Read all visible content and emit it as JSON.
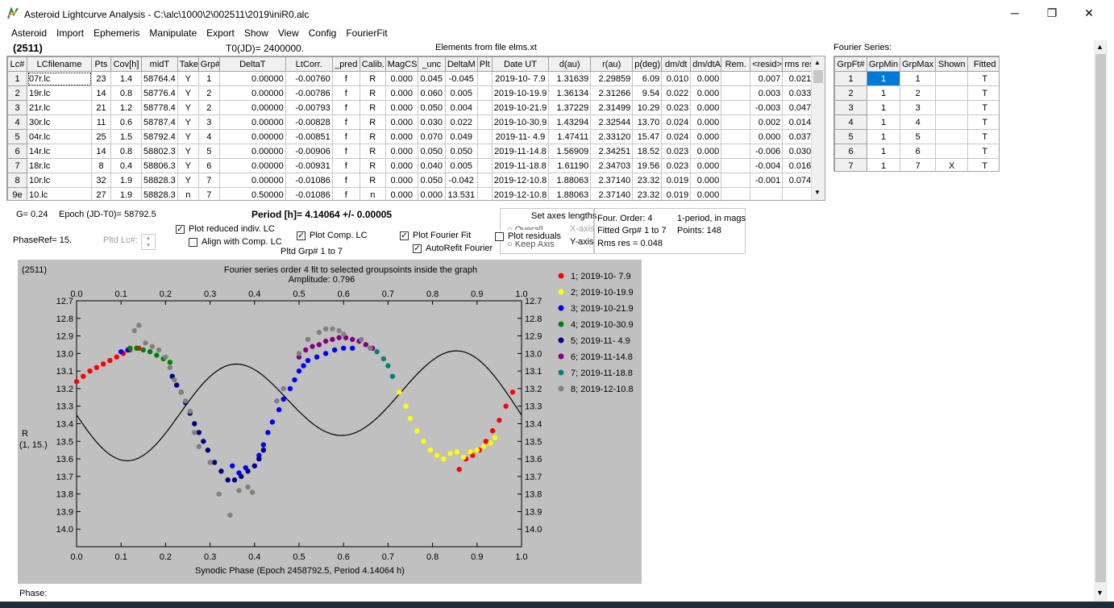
{
  "window": {
    "title": "Asteroid Lightcurve Analysis - C:\\alc\\1000\\2\\002511\\2019\\iniR0.alc",
    "min": "─",
    "max": "❐",
    "close": "✕"
  },
  "menu": [
    "Asteroid",
    "Import",
    "Ephemeris",
    "Manipulate",
    "Export",
    "Show",
    "View",
    "Config",
    "FourierFit"
  ],
  "header": {
    "asteroid": "(2511)",
    "t0": "T0(JD)= 2400000.",
    "elements": "Elements from file elms.xt"
  },
  "grid": {
    "columns": [
      "Lc#",
      "LCfilename",
      "Pts",
      "Cov[h]",
      "midT",
      "Take",
      "Grp#",
      "DeltaT",
      "LtCorr.",
      "_pred",
      "Calib.",
      "MagCS",
      "_unc",
      "DeltaM",
      "Plt",
      "Date UT",
      "d(au)",
      "r(au)",
      "p(deg)",
      "dm/dt",
      "dm/dtA",
      "Rem.",
      "<resid>",
      "rms res"
    ],
    "rows": [
      [
        "1",
        "07r.lc",
        "23",
        "1.4",
        "58764.4",
        "Y",
        "1",
        "0.00000",
        "-0.00760",
        "f",
        "R",
        "0.000",
        "0.045",
        "-0.045",
        "",
        "2019-10- 7.9",
        "1.31639",
        "2.29859",
        "6.09",
        "0.010",
        "0.000",
        "",
        "0.007",
        "0.021"
      ],
      [
        "2",
        "19r.lc",
        "14",
        "0.8",
        "58776.4",
        "Y",
        "2",
        "0.00000",
        "-0.00786",
        "f",
        "R",
        "0.000",
        "0.060",
        "0.005",
        "",
        "2019-10-19.9",
        "1.36134",
        "2.31266",
        "9.54",
        "0.022",
        "0.000",
        "",
        "0.003",
        "0.033"
      ],
      [
        "3",
        "21r.lc",
        "21",
        "1.2",
        "58778.4",
        "Y",
        "2",
        "0.00000",
        "-0.00793",
        "f",
        "R",
        "0.000",
        "0.050",
        "0.004",
        "",
        "2019-10-21.9",
        "1.37229",
        "2.31499",
        "10.29",
        "0.023",
        "0.000",
        "",
        "-0.003",
        "0.047"
      ],
      [
        "4",
        "30r.lc",
        "11",
        "0.6",
        "58787.4",
        "Y",
        "3",
        "0.00000",
        "-0.00828",
        "f",
        "R",
        "0.000",
        "0.030",
        "0.022",
        "",
        "2019-10-30.9",
        "1.43294",
        "2.32544",
        "13.70",
        "0.024",
        "0.000",
        "",
        "0.002",
        "0.014"
      ],
      [
        "5",
        "04r.lc",
        "25",
        "1.5",
        "58792.4",
        "Y",
        "4",
        "0.00000",
        "-0.00851",
        "f",
        "R",
        "0.000",
        "0.070",
        "0.049",
        "",
        "2019-11- 4.9",
        "1.47411",
        "2.33120",
        "15.47",
        "0.024",
        "0.000",
        "",
        "0.000",
        "0.037"
      ],
      [
        "6",
        "14r.lc",
        "14",
        "0.8",
        "58802.3",
        "Y",
        "5",
        "0.00000",
        "-0.00906",
        "f",
        "R",
        "0.000",
        "0.050",
        "0.050",
        "",
        "2019-11-14.8",
        "1.56909",
        "2.34251",
        "18.52",
        "0.023",
        "0.000",
        "",
        "-0.006",
        "0.030"
      ],
      [
        "7",
        "18r.lc",
        "8",
        "0.4",
        "58806.3",
        "Y",
        "6",
        "0.00000",
        "-0.00931",
        "f",
        "R",
        "0.000",
        "0.040",
        "0.005",
        "",
        "2019-11-18.8",
        "1.61190",
        "2.34703",
        "19.56",
        "0.023",
        "0.000",
        "",
        "-0.004",
        "0.016"
      ],
      [
        "8",
        "10r.lc",
        "32",
        "1.9",
        "58828.3",
        "Y",
        "7",
        "0.00000",
        "-0.01086",
        "f",
        "R",
        "0.000",
        "0.050",
        "-0.042",
        "",
        "2019-12-10.8",
        "1.88063",
        "2.37140",
        "23.32",
        "0.019",
        "0.000",
        "",
        "-0.001",
        "0.074"
      ],
      [
        "9e",
        "10.lc",
        "27",
        "1.9",
        "58828.3",
        "n",
        "7",
        "0.50000",
        "-0.01086",
        "f",
        "n",
        "0.000",
        "0.000",
        "13.531",
        "",
        "2019-12-10.8",
        "1.88063",
        "2.37140",
        "23.32",
        "0.019",
        "0.000",
        "",
        "",
        ""
      ]
    ]
  },
  "fourier_panel": {
    "title": "Fourier Series:",
    "columns": [
      "GrpFt#",
      "GrpMin",
      "GrpMax",
      "Shown",
      "Fitted"
    ],
    "rows": [
      [
        "1",
        "1",
        "1",
        "",
        "T"
      ],
      [
        "2",
        "1",
        "2",
        "",
        "T"
      ],
      [
        "3",
        "1",
        "3",
        "",
        "T"
      ],
      [
        "4",
        "1",
        "4",
        "",
        "T"
      ],
      [
        "5",
        "1",
        "5",
        "",
        "T"
      ],
      [
        "6",
        "1",
        "6",
        "",
        "T"
      ],
      [
        "7",
        "1",
        "7",
        "X",
        "T"
      ]
    ]
  },
  "controls": {
    "g": "G= 0.24",
    "epoch": "Epoch (JD-T0)= 58792.5",
    "period": "Period [h]= 4.14064 +/- 0.00005",
    "phaseref": "PhaseRef= 15.",
    "pltd_lc": "Pltd Lc#:",
    "plot_reduced": "Plot reduced indiv. LC",
    "align_comp": "Align with Comp. LC",
    "plot_comp": "Plot Comp. LC",
    "pltd_grp": "Pltd Grp#  1   to   7",
    "plot_fourier": "Plot Fourier Fit",
    "autorefit": "AutoRefit Fourier",
    "set_axes": "Set axes lengths",
    "overall": "Overall",
    "keep_axis": "Keep Axis",
    "plot_residuals": "Plot residuals",
    "x_axis": "X-axis",
    "y_axis": "Y-axis",
    "check_mark": "✓",
    "shown_mark": "X",
    "four_order": "Four. Order:  4",
    "one_period": "1-period, in mags",
    "fitted_grp": "Fitted Grp# 1 to 7",
    "points": "Points: 148",
    "rms_res": "Rms res      = 0.048",
    "phase_label": "Phase:"
  },
  "chart_data": {
    "type": "scatter",
    "corner_label": "(2511)",
    "title": "Fourier series order 4 fit to selected groupsoints inside the graph",
    "subtitle": "Amplitude: 0.796",
    "xlabel": "Synodic Phase (Epoch 2458792.5, Period 4.14064 h)",
    "ylabel": "R",
    "ylabel2": "(1, 15.)",
    "xlim": [
      0.0,
      1.0
    ],
    "ylim": [
      12.7,
      14.1
    ],
    "y_inverted": true,
    "x_ticks": [
      "0.0",
      "0.1",
      "0.2",
      "0.3",
      "0.4",
      "0.5",
      "0.6",
      "0.7",
      "0.8",
      "0.9",
      "1.0"
    ],
    "y_ticks": [
      "12.7",
      "12.8",
      "12.9",
      "13.0",
      "13.1",
      "13.2",
      "13.3",
      "13.4",
      "13.5",
      "13.6",
      "13.7",
      "13.8",
      "13.9",
      "14.0"
    ],
    "fourier_curve": {
      "mean": 13.28,
      "a": [
        0.02,
        0.06,
        -0.01,
        0.0
      ],
      "b": [
        0.07,
        0.25,
        0.01,
        0.0
      ],
      "color": "#000000"
    },
    "series": [
      {
        "name": "1; 2019-10- 7.9",
        "color": "#ff0000",
        "points": [
          [
            0.0,
            13.16
          ],
          [
            0.015,
            13.13
          ],
          [
            0.03,
            13.1
          ],
          [
            0.045,
            13.08
          ],
          [
            0.06,
            13.06
          ],
          [
            0.075,
            13.04
          ],
          [
            0.09,
            13.02
          ],
          [
            0.105,
            13.0
          ],
          [
            0.12,
            12.98
          ],
          [
            0.14,
            12.97
          ],
          [
            0.86,
            13.66
          ],
          [
            0.875,
            13.6
          ],
          [
            0.89,
            13.58
          ],
          [
            0.905,
            13.55
          ],
          [
            0.92,
            13.5
          ],
          [
            0.935,
            13.44
          ],
          [
            0.95,
            13.38
          ],
          [
            0.965,
            13.3
          ],
          [
            0.98,
            13.22
          ]
        ]
      },
      {
        "name": "2; 2019-10-19.9",
        "color": "#ffff00",
        "points": [
          [
            0.725,
            13.22
          ],
          [
            0.74,
            13.3
          ],
          [
            0.75,
            13.37
          ],
          [
            0.765,
            13.44
          ],
          [
            0.78,
            13.5
          ],
          [
            0.795,
            13.55
          ],
          [
            0.81,
            13.58
          ],
          [
            0.825,
            13.6
          ],
          [
            0.84,
            13.57
          ],
          [
            0.855,
            13.56
          ],
          [
            0.87,
            13.59
          ],
          [
            0.885,
            13.56
          ],
          [
            0.9,
            13.55
          ],
          [
            0.915,
            13.53
          ],
          [
            0.93,
            13.51
          ],
          [
            0.94,
            13.48
          ]
        ]
      },
      {
        "name": "3; 2019-10-21.9",
        "color": "#0000ff",
        "points": [
          [
            0.1,
            12.99
          ],
          [
            0.115,
            12.98
          ],
          [
            0.35,
            13.64
          ],
          [
            0.365,
            13.68
          ],
          [
            0.38,
            13.65
          ],
          [
            0.41,
            13.58
          ],
          [
            0.42,
            13.52
          ],
          [
            0.43,
            13.45
          ],
          [
            0.44,
            13.39
          ],
          [
            0.455,
            13.32
          ],
          [
            0.465,
            13.26
          ],
          [
            0.48,
            13.2
          ],
          [
            0.49,
            13.15
          ],
          [
            0.5,
            13.1
          ],
          [
            0.51,
            13.07
          ],
          [
            0.52,
            13.04
          ],
          [
            0.54,
            13.02
          ],
          [
            0.56,
            13.0
          ],
          [
            0.58,
            12.98
          ],
          [
            0.6,
            12.97
          ],
          [
            0.62,
            12.97
          ]
        ]
      },
      {
        "name": "4; 2019-10-30.9",
        "color": "#008000",
        "points": [
          [
            0.12,
            12.97
          ],
          [
            0.135,
            12.97
          ],
          [
            0.15,
            12.98
          ],
          [
            0.165,
            12.99
          ],
          [
            0.18,
            13.01
          ],
          [
            0.195,
            13.03
          ],
          [
            0.21,
            13.05
          ]
        ]
      },
      {
        "name": "5; 2019-11- 4.9",
        "color": "#000080",
        "points": [
          [
            0.215,
            13.13
          ],
          [
            0.225,
            13.18
          ],
          [
            0.235,
            13.22
          ],
          [
            0.245,
            13.28
          ],
          [
            0.255,
            13.34
          ],
          [
            0.265,
            13.4
          ],
          [
            0.275,
            13.45
          ],
          [
            0.285,
            13.5
          ],
          [
            0.295,
            13.55
          ],
          [
            0.31,
            13.62
          ],
          [
            0.325,
            13.67
          ],
          [
            0.34,
            13.72
          ],
          [
            0.355,
            13.72
          ],
          [
            0.37,
            13.7
          ],
          [
            0.385,
            13.67
          ],
          [
            0.4,
            13.64
          ],
          [
            0.41,
            13.6
          ],
          [
            0.42,
            13.55
          ]
        ]
      },
      {
        "name": "6; 2019-11-14.8",
        "color": "#800080",
        "points": [
          [
            0.5,
            13.02
          ],
          [
            0.515,
            12.98
          ],
          [
            0.53,
            12.96
          ],
          [
            0.545,
            12.95
          ],
          [
            0.56,
            12.93
          ],
          [
            0.575,
            12.92
          ],
          [
            0.59,
            12.91
          ],
          [
            0.605,
            12.91
          ],
          [
            0.62,
            12.92
          ],
          [
            0.635,
            12.93
          ],
          [
            0.65,
            12.95
          ],
          [
            0.665,
            12.97
          ]
        ]
      },
      {
        "name": "7; 2019-11-18.8",
        "color": "#008080",
        "points": [
          [
            0.66,
            12.97
          ],
          [
            0.675,
            12.99
          ],
          [
            0.69,
            13.03
          ],
          [
            0.7,
            13.07
          ],
          [
            0.71,
            13.13
          ]
        ]
      },
      {
        "name": "8; 2019-12-10.8",
        "color": "#808080",
        "points": [
          [
            0.13,
            12.87
          ],
          [
            0.14,
            12.84
          ],
          [
            0.155,
            12.94
          ],
          [
            0.17,
            12.96
          ],
          [
            0.185,
            12.98
          ],
          [
            0.2,
            13.02
          ],
          [
            0.21,
            13.08
          ],
          [
            0.22,
            13.15
          ],
          [
            0.235,
            13.22
          ],
          [
            0.245,
            13.27
          ],
          [
            0.255,
            13.33
          ],
          [
            0.265,
            13.45
          ],
          [
            0.275,
            13.53
          ],
          [
            0.3,
            13.62
          ],
          [
            0.32,
            13.8
          ],
          [
            0.345,
            13.92
          ],
          [
            0.365,
            13.78
          ],
          [
            0.385,
            13.76
          ],
          [
            0.395,
            13.79
          ],
          [
            0.45,
            13.27
          ],
          [
            0.465,
            13.2
          ],
          [
            0.5,
            13.0
          ],
          [
            0.52,
            12.92
          ],
          [
            0.545,
            12.88
          ],
          [
            0.56,
            12.86
          ],
          [
            0.575,
            12.86
          ],
          [
            0.59,
            12.87
          ],
          [
            0.6,
            12.89
          ],
          [
            0.64,
            12.92
          ],
          [
            0.66,
            12.97
          ]
        ]
      }
    ]
  }
}
